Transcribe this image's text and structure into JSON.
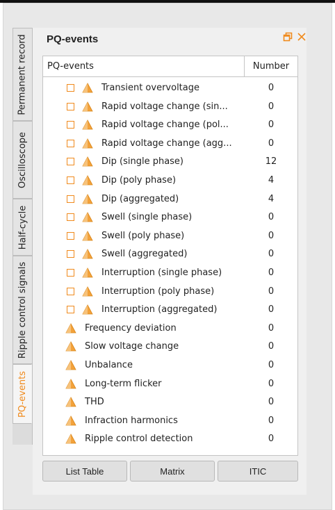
{
  "panel": {
    "title": "PQ-events"
  },
  "tabs": [
    {
      "label": "Permanent record"
    },
    {
      "label": "Oscilloscope"
    },
    {
      "label": "Half-cycle"
    },
    {
      "label": "Ripple control signals"
    },
    {
      "label": "PQ-events",
      "active": true
    }
  ],
  "table": {
    "col_name": "PQ-events",
    "col_number": "Number",
    "rows": [
      {
        "label": "Transient overvoltage",
        "value": "0",
        "checkbox": true
      },
      {
        "label": "Rapid voltage change (sin...",
        "value": "0",
        "checkbox": true
      },
      {
        "label": "Rapid voltage change (pol...",
        "value": "0",
        "checkbox": true
      },
      {
        "label": "Rapid voltage change (agg...",
        "value": "0",
        "checkbox": true
      },
      {
        "label": "Dip (single phase)",
        "value": "12",
        "checkbox": true
      },
      {
        "label": "Dip (poly phase)",
        "value": "4",
        "checkbox": true
      },
      {
        "label": "Dip (aggregated)",
        "value": "4",
        "checkbox": true
      },
      {
        "label": "Swell (single phase)",
        "value": "0",
        "checkbox": true
      },
      {
        "label": "Swell (poly phase)",
        "value": "0",
        "checkbox": true
      },
      {
        "label": "Swell (aggregated)",
        "value": "0",
        "checkbox": true
      },
      {
        "label": "Interruption (single phase)",
        "value": "0",
        "checkbox": true
      },
      {
        "label": "Interruption (poly phase)",
        "value": "0",
        "checkbox": true
      },
      {
        "label": "Interruption (aggregated)",
        "value": "0",
        "checkbox": true
      },
      {
        "label": "Frequency deviation",
        "value": "0",
        "checkbox": false
      },
      {
        "label": "Slow voltage change",
        "value": "0",
        "checkbox": false
      },
      {
        "label": "Unbalance",
        "value": "0",
        "checkbox": false
      },
      {
        "label": "Long-term flicker",
        "value": "0",
        "checkbox": false
      },
      {
        "label": "THD",
        "value": "0",
        "checkbox": false
      },
      {
        "label": "Infraction harmonics",
        "value": "0",
        "checkbox": false
      },
      {
        "label": "Ripple control detection",
        "value": "0",
        "checkbox": false
      }
    ]
  },
  "buttons": {
    "list_table": "List Table",
    "matrix": "Matrix",
    "itic": "ITIC"
  },
  "icons": {
    "row_icon": "warning-triangle-icon",
    "restore": "restore-window-icon",
    "close": "close-icon"
  },
  "colors": {
    "accent": "#f08a1c"
  }
}
